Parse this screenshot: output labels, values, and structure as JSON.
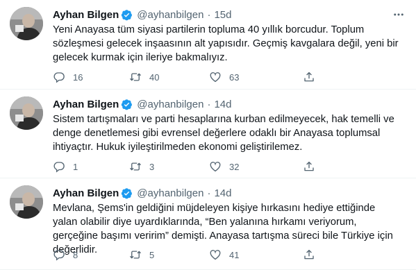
{
  "colors": {
    "verified": "#1d9bf0",
    "text": "#0f1419",
    "muted": "#536471",
    "divider": "#eff3f4"
  },
  "tweets": [
    {
      "author": {
        "name": "Ayhan Bilgen",
        "handle": "@ayhanbilgen",
        "verified": true
      },
      "separator": "·",
      "time": "15d",
      "text": "Yeni Anayasa tüm siyasi partilerin topluma 40 yıllık borcudur. Toplum sözleşmesi gelecek inşaasının alt yapısıdır. Geçmiş kavgalara değil, yeni bir gelecek kurmak için ileriye bakmalıyız.",
      "replies": "16",
      "retweets": "40",
      "likes": "63"
    },
    {
      "author": {
        "name": "Ayhan Bilgen",
        "handle": "@ayhanbilgen",
        "verified": true
      },
      "separator": "·",
      "time": "14d",
      "text": "Sistem tartışmaları ve parti hesaplarına kurban edilmeyecek, hak temelli ve denge denetlemesi gibi evrensel değerlere odaklı bir Anayasa toplumsal ihtiyaçtır. Hukuk iyileştirilmeden ekonomi geliştirilemez.",
      "replies": "1",
      "retweets": "3",
      "likes": "32"
    },
    {
      "author": {
        "name": "Ayhan Bilgen",
        "handle": "@ayhanbilgen",
        "verified": true
      },
      "separator": "·",
      "time": "14d",
      "text": "Mevlana, Şems'in geldiğini müjdeleyen kişiye hırkasını hediye ettiğinde yalan olabilir diye uyardıklarında, “Ben yalanına hırkamı veriyorum, gerçeğine başımı veririm” demişti. Anayasa tartışma süreci bile Türkiye için değerlidir.",
      "replies": "8",
      "retweets": "5",
      "likes": "41"
    }
  ],
  "icons": {
    "more": "more-horizontal-icon",
    "reply": "reply-icon",
    "retweet": "retweet-icon",
    "like": "heart-icon",
    "share": "share-icon",
    "verified": "verified-badge-icon"
  }
}
